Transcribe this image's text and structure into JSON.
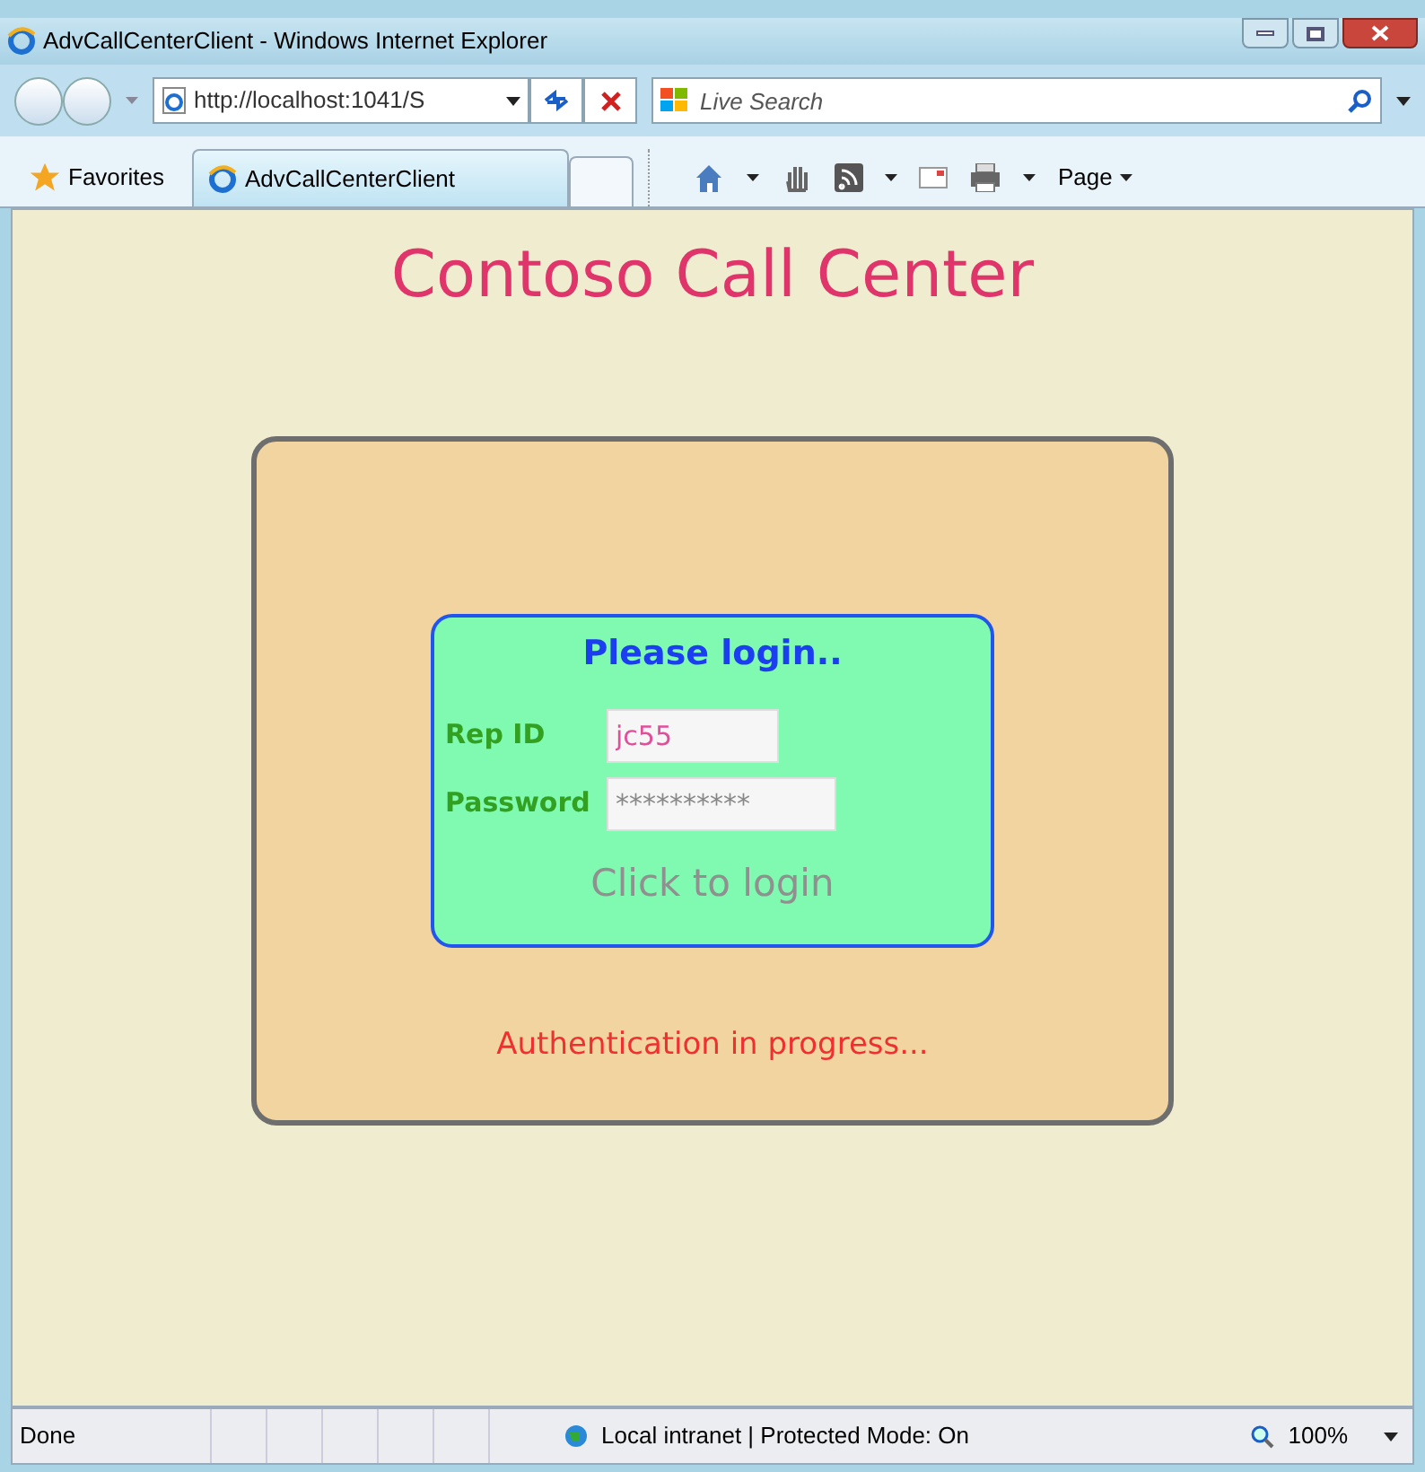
{
  "window": {
    "title": "AdvCallCenterClient - Windows Internet Explorer"
  },
  "address_bar": {
    "url": "http://localhost:1041/S"
  },
  "search": {
    "placeholder": "Live Search"
  },
  "favorites": {
    "label": "Favorites"
  },
  "tab": {
    "label": "AdvCallCenterClient",
    "selected": true
  },
  "toolbar": {
    "page_menu": "Page"
  },
  "page": {
    "heading": "Contoso Call Center",
    "login": {
      "title": "Please login..",
      "fields": [
        {
          "label": "Rep ID",
          "value": "jc55"
        },
        {
          "label": "Password",
          "value": "**********"
        }
      ],
      "button": "Click to login",
      "disabled": true
    },
    "status_message": "Authentication in progress..."
  },
  "status_bar": {
    "text": "Done",
    "zone": "Local intranet | Protected Mode: On",
    "zoom": "100%"
  }
}
